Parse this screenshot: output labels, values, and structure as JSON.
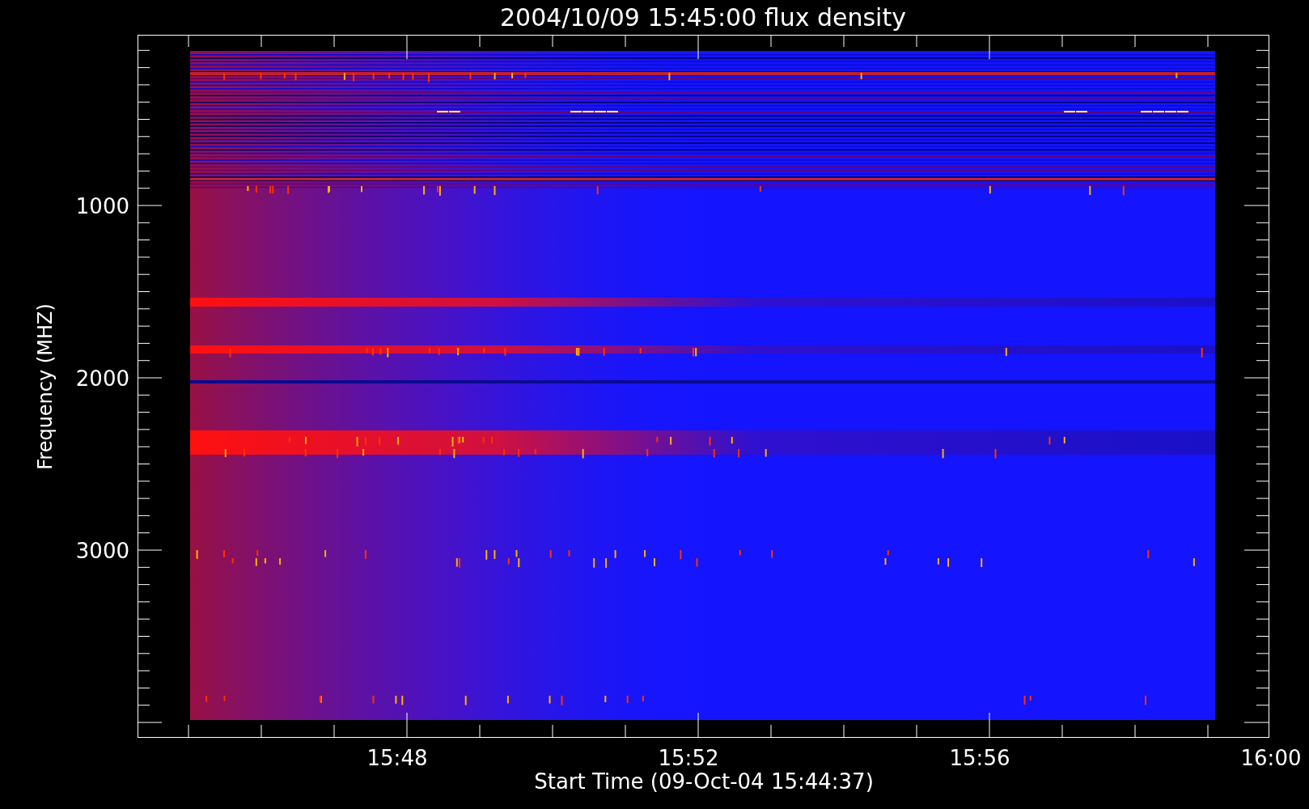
{
  "title": "2004/10/09 15:45:00 flux density",
  "y_axis": {
    "label": "Frequency (MHZ)",
    "tick_labels": [
      "1000",
      "2000",
      "3000"
    ]
  },
  "x_axis": {
    "label": "Start Time (09-Oct-04 15:44:37)",
    "tick_labels": [
      "15:48",
      "15:52",
      "15:56",
      "16:00"
    ]
  }
}
